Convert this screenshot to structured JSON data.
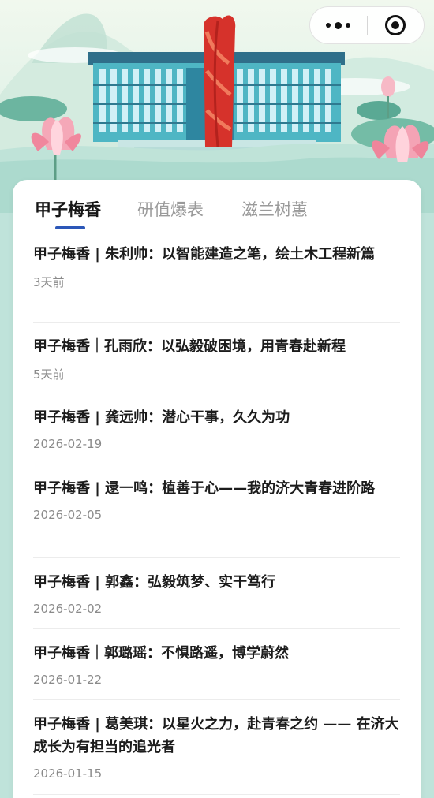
{
  "header": {
    "capsule": {
      "more_icon": "more-dots-icon",
      "close_icon": "target-circle-icon"
    }
  },
  "tabs": [
    {
      "label": "甲子梅香",
      "active": true
    },
    {
      "label": "研值爆表",
      "active": false
    },
    {
      "label": "滋兰树蕙",
      "active": false
    }
  ],
  "articles": [
    {
      "title": "甲子梅香 | 朱利帅：以智能建造之笔，绘土木工程新篇",
      "date": "3天前"
    },
    {
      "title": "甲子梅香｜孔雨欣：以弘毅破困境，用青春赴新程",
      "date": "5天前"
    },
    {
      "title": "甲子梅香 | 龚远帅：潜心干事，久久为功",
      "date": "2026-02-19"
    },
    {
      "title": "甲子梅香 | 逯一鸣：植善于心——我的济大青春进阶路",
      "date": "2026-02-05"
    },
    {
      "title": "甲子梅香 | 郭鑫：弘毅筑梦、实干笃行",
      "date": "2026-02-02"
    },
    {
      "title": "甲子梅香｜郭璐瑶：不惧路遥，博学蔚然",
      "date": "2026-01-22"
    },
    {
      "title": "甲子梅香 | 葛美琪：以星火之力，赴青春之约 —— 在济大成长为有担当的追光者",
      "date": "2026-01-15"
    }
  ],
  "colors": {
    "accent": "#2c57b8",
    "monument": "#d6322b",
    "building": "#3aa5b5"
  }
}
